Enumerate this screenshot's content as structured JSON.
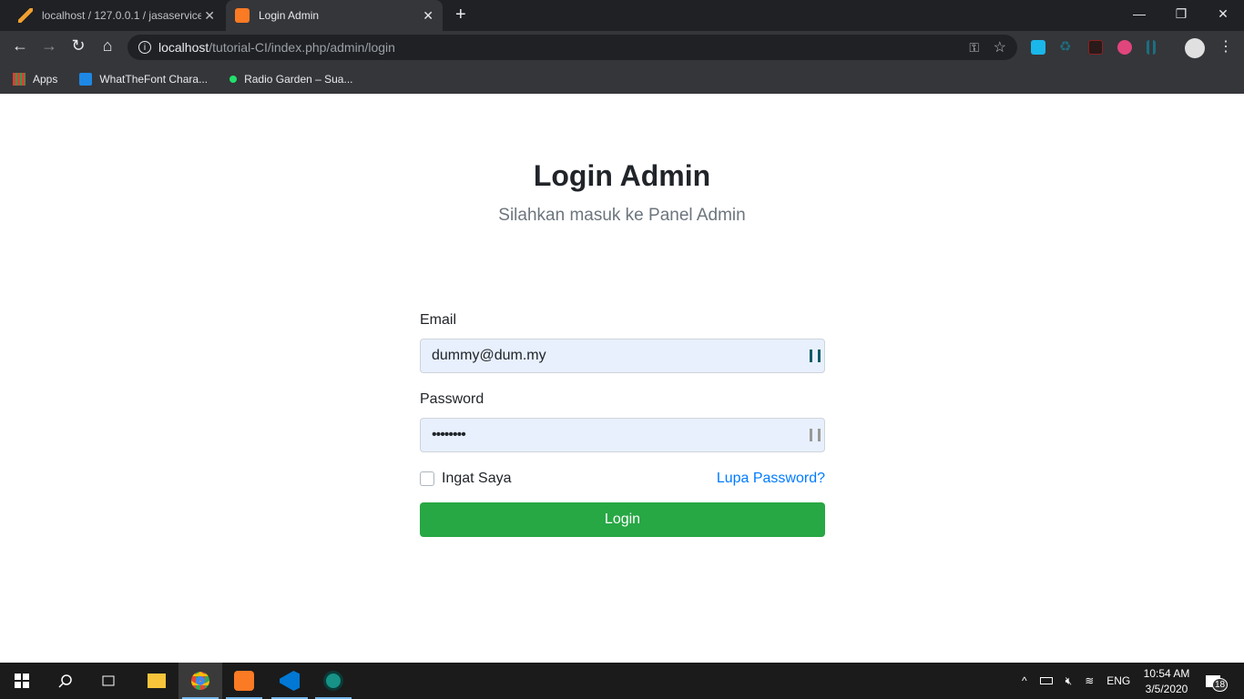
{
  "browser": {
    "tabs": [
      {
        "title": "localhost / 127.0.0.1 / jasaservice",
        "active": false
      },
      {
        "title": "Login Admin",
        "active": true
      }
    ],
    "close_glyph": "✕",
    "new_tab_glyph": "+",
    "window_controls": {
      "minimize": "—",
      "restore": "❐",
      "close": "✕"
    },
    "address": {
      "host": "localhost",
      "path": "/tutorial-CI/index.php/admin/login"
    },
    "bookmarks": [
      {
        "label": "Apps",
        "icon": "apps-grid-icon"
      },
      {
        "label": "WhatTheFont Chara...",
        "icon": "whatthefont-icon"
      },
      {
        "label": "Radio Garden – Sua...",
        "icon": "radio-garden-icon"
      }
    ],
    "colors": {
      "tabbar": "#202124",
      "toolbar": "#35363a"
    }
  },
  "page": {
    "title": "Login Admin",
    "subtitle": "Silahkan masuk ke Panel Admin",
    "email": {
      "label": "Email",
      "value": "dummy@dum.my"
    },
    "password": {
      "label": "Password",
      "value": "••••••••"
    },
    "remember": {
      "label": "Ingat Saya",
      "checked": false
    },
    "forgot": "Lupa Password?",
    "submit": "Login",
    "colors": {
      "button": "#28a745",
      "link": "#007bff",
      "input_bg": "#e8f0fe"
    }
  },
  "taskbar": {
    "apps": [
      "windows-start",
      "search",
      "task-view",
      "file-explorer",
      "chrome",
      "xampp",
      "vscode",
      "gitkraken"
    ],
    "tray": {
      "language": "ENG",
      "time": "10:54 AM",
      "date": "3/5/2020",
      "notifications": "18"
    }
  }
}
